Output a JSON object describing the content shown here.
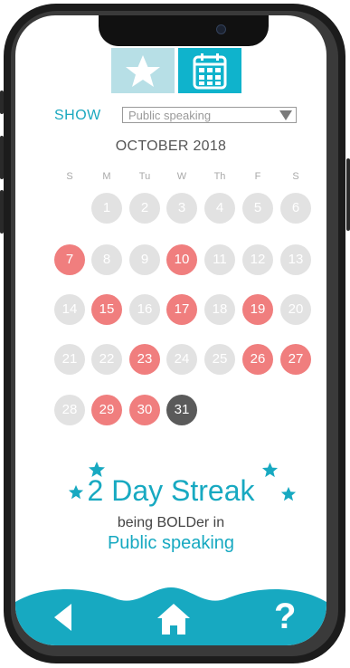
{
  "tabs": [
    {
      "name": "star-icon",
      "active": false
    },
    {
      "name": "calendar-icon",
      "active": true
    }
  ],
  "filter": {
    "label": "SHOW",
    "value": "Public speaking"
  },
  "calendar": {
    "month": "OCTOBER 2018",
    "weekdays": [
      "S",
      "M",
      "Tu",
      "W",
      "Th",
      "F",
      "S"
    ],
    "first_weekday_index": 1,
    "days_in_month": 31,
    "hit_days": [
      7,
      10,
      15,
      17,
      19,
      23,
      26,
      27,
      29,
      30
    ],
    "today": 31
  },
  "streak": {
    "title": "2 Day Streak",
    "subtitle": "being BOLDer in",
    "skill": "Public speaking"
  },
  "nav": {
    "back_icon": "back-arrow-icon",
    "home_icon": "home-icon",
    "help_label": "?"
  },
  "colors": {
    "accent": "#17a9c1",
    "hit": "#f07e7e",
    "off": "#e2e2e2",
    "today": "#5a5a5a"
  }
}
